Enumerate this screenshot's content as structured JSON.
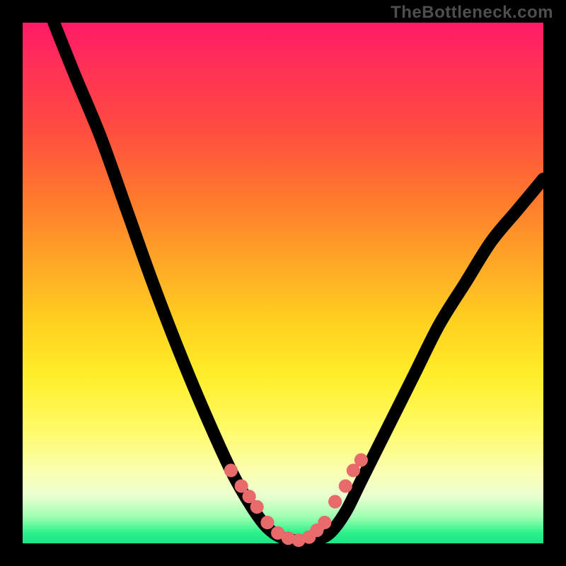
{
  "watermark": "TheBottleneck.com",
  "colors": {
    "frame_bg": "#000000",
    "watermark_text": "#4e4e4e",
    "curve_stroke": "#000000",
    "dot_fill": "#e86a6a",
    "gradient_top": "#ff1a66",
    "gradient_mid": "#ffd21f",
    "gradient_bottom": "#1de28a"
  },
  "chart_data": {
    "type": "line",
    "title": "",
    "xlabel": "",
    "ylabel": "",
    "xlim": [
      0,
      100
    ],
    "ylim": [
      0,
      100
    ],
    "grid": false,
    "legend": false,
    "series": [
      {
        "name": "bottleneck-curve",
        "x": [
          6,
          10,
          15,
          20,
          25,
          30,
          35,
          40,
          44,
          47,
          50,
          53,
          56,
          59,
          62,
          65,
          70,
          75,
          80,
          85,
          90,
          95,
          100
        ],
        "y": [
          100,
          90,
          78,
          64,
          50,
          37,
          25,
          14,
          7,
          3,
          1,
          0.5,
          0.6,
          2,
          6,
          12,
          22,
          32,
          42,
          50,
          58,
          64,
          70
        ]
      }
    ],
    "annotations": {
      "highlight_dots": {
        "comment": "salmon dots near the valley of the curve",
        "x": [
          40,
          42,
          43.5,
          45,
          47,
          49,
          51,
          53,
          55,
          56.5,
          58,
          60,
          62,
          63.5,
          65
        ],
        "y": [
          14,
          11,
          9,
          7,
          4,
          2,
          1,
          0.6,
          1.2,
          2.5,
          4,
          8,
          11,
          14,
          16
        ]
      }
    }
  }
}
